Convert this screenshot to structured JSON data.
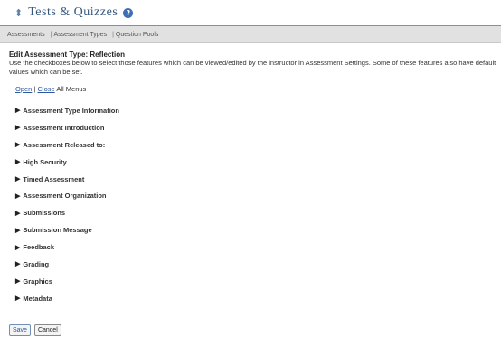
{
  "header": {
    "title": "Tests & Quizzes",
    "help_icon": "question-icon"
  },
  "toolbar": {
    "assessments": "Assessments",
    "assessment_types": "Assessment Types",
    "question_pools": "Question Pools"
  },
  "main": {
    "heading": "Edit Assessment Type: Reflection",
    "description": "Use the checkboxes below to select those features which can be viewed/edited by the instructor in Assessment Settings. Some of these features also have default values which can be set.",
    "open_label": "Open",
    "separator": "|",
    "close_label": "Close",
    "all_menus_label": "All Menus",
    "sections": [
      "Assessment Type Information",
      "Assessment Introduction",
      "Assessment Released to:",
      "High Security",
      "Timed Assessment",
      "Assessment Organization",
      "Submissions",
      "Submission Message",
      "Feedback",
      "Grading",
      "Graphics",
      "Metadata"
    ]
  },
  "buttons": {
    "save": "Save",
    "cancel": "Cancel"
  }
}
